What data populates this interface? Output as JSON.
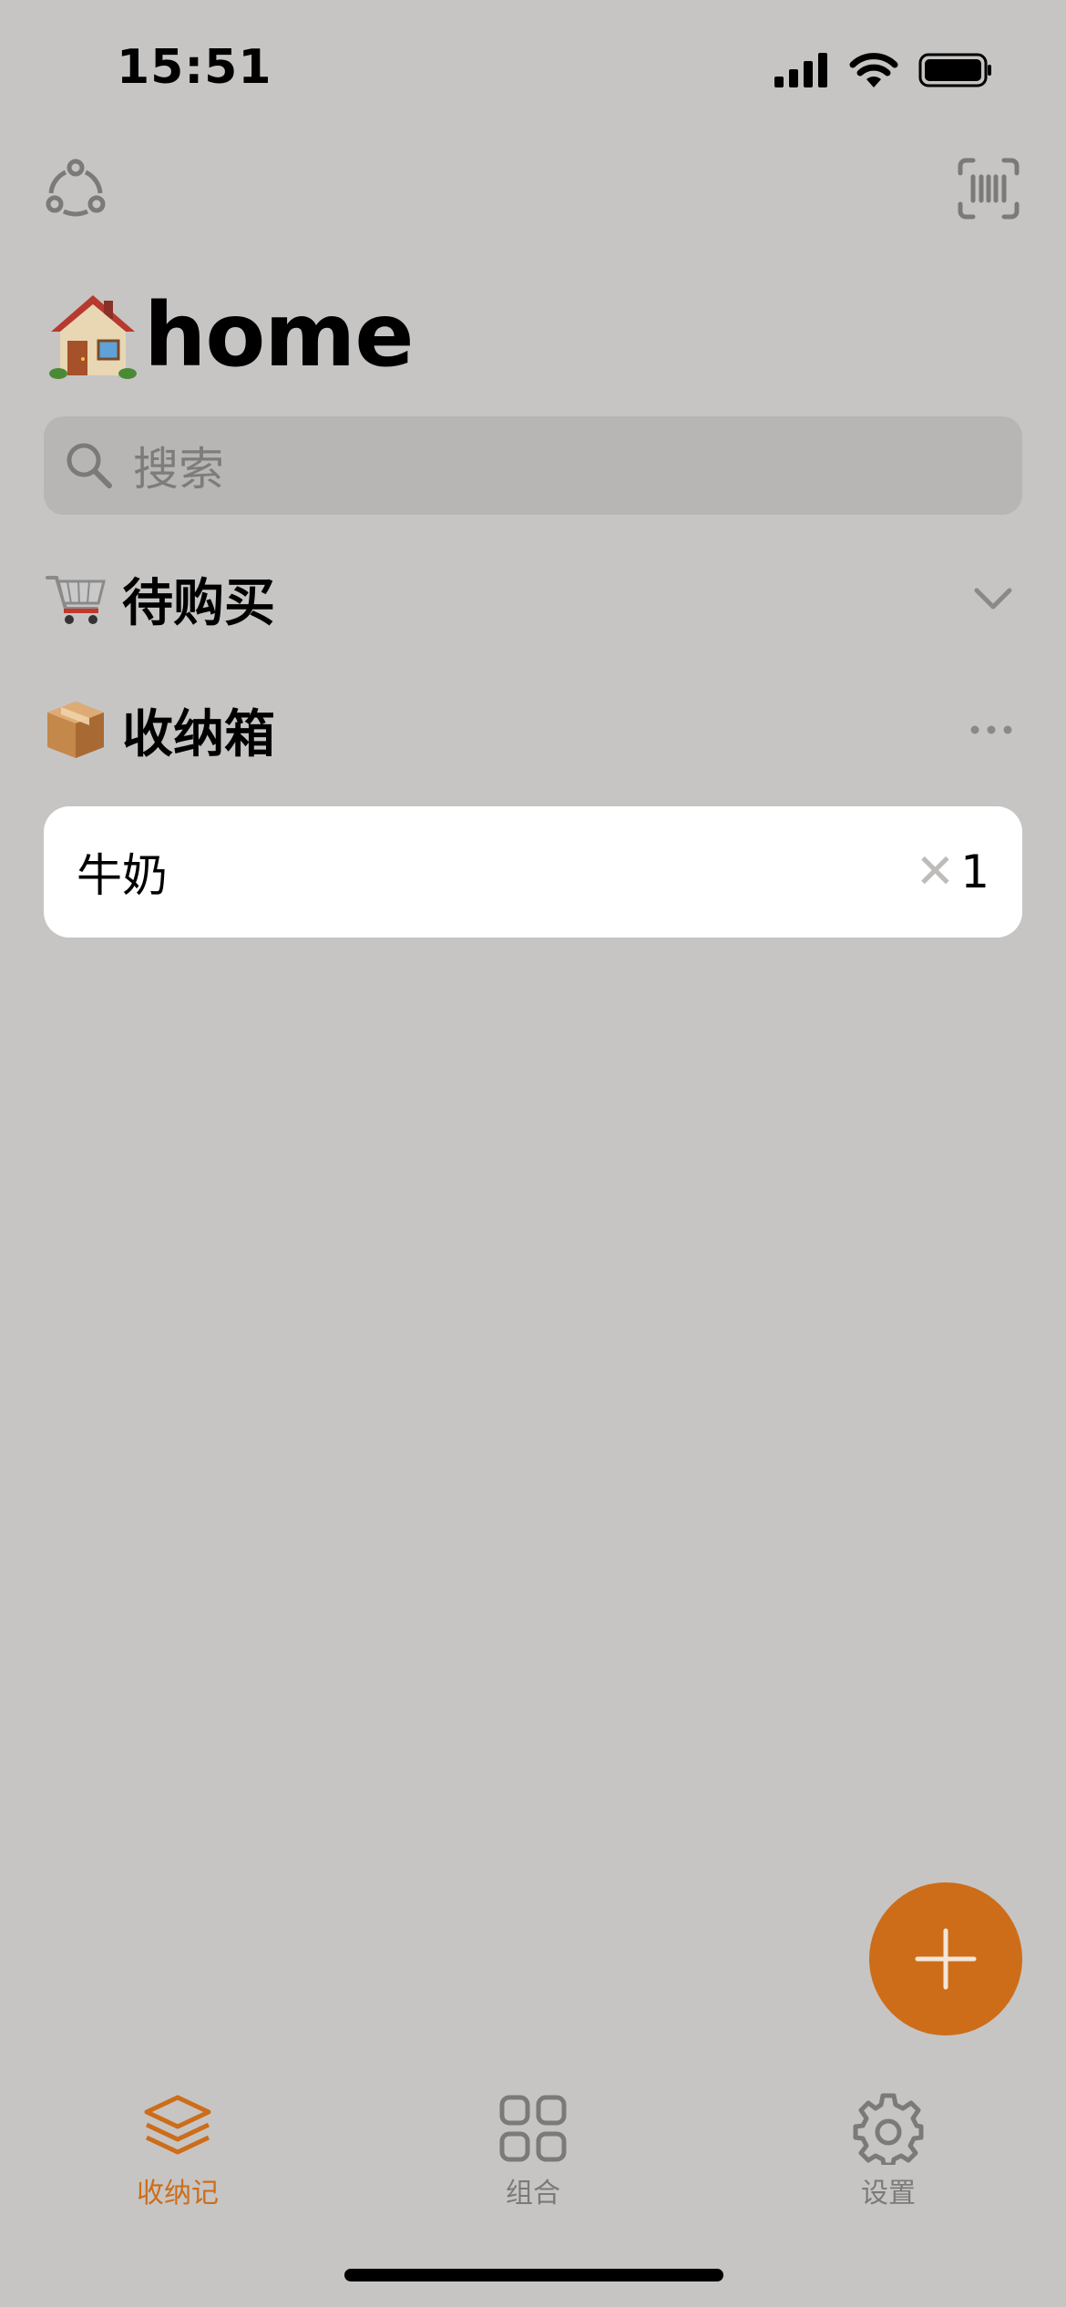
{
  "status_bar": {
    "time": "15:51"
  },
  "page": {
    "title": "home",
    "title_emoji": "house-emoji"
  },
  "search": {
    "placeholder": "搜索"
  },
  "sections": [
    {
      "emoji": "shopping-cart-emoji",
      "label": "待购买",
      "action": "chevron-down-icon"
    },
    {
      "emoji": "package-emoji",
      "label": "收纳箱",
      "action": "more-icon"
    }
  ],
  "items": [
    {
      "name": "牛奶",
      "multiplier": "✕",
      "quantity": "1"
    }
  ],
  "tabbar": {
    "tabs": [
      {
        "label": "收纳记",
        "icon": "layers-icon",
        "active": true
      },
      {
        "label": "组合",
        "icon": "grid-icon",
        "active": false
      },
      {
        "label": "设置",
        "icon": "gear-icon",
        "active": false
      }
    ]
  },
  "colors": {
    "accent": "#cd6d19",
    "background": "#c6c5c4",
    "search_bg": "#b7b6b5",
    "card_bg": "#ffffff"
  }
}
